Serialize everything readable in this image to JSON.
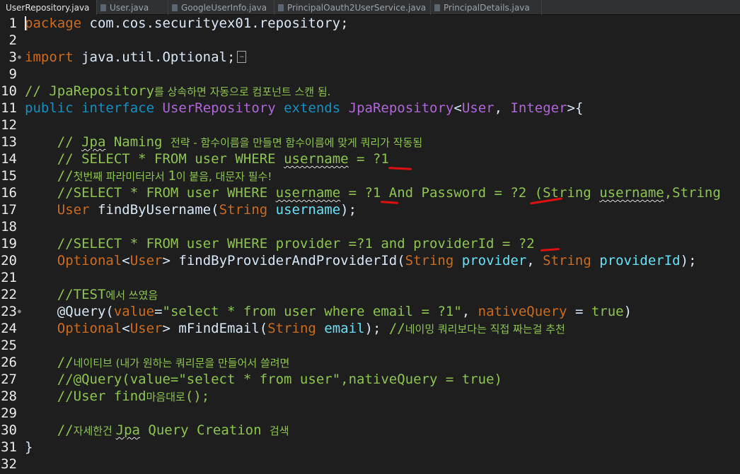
{
  "tabs": [
    {
      "label": "UserRepository.java",
      "close": "✕",
      "active": true
    },
    {
      "label": "User.java",
      "active": false
    },
    {
      "label": "GoogleUserInfo.java",
      "active": false
    },
    {
      "label": "PrincipalOauth2UserService.java",
      "active": false
    },
    {
      "label": "PrincipalDetails.java",
      "active": false
    }
  ],
  "line_numbers": [
    "1",
    "2",
    "3",
    "9",
    "10",
    "11",
    "12",
    "13",
    "14",
    "15",
    "16",
    "17",
    "18",
    "19",
    "20",
    "21",
    "22",
    "23",
    "24",
    "25",
    "26",
    "27",
    "28",
    "29",
    "30",
    "31",
    "32"
  ],
  "code": {
    "l1": {
      "kw": "package",
      "rest": " com.cos.securityex01.repository;"
    },
    "l3": {
      "kw": "import",
      "rest": " java.util.Optional;",
      "fold_box": "…"
    },
    "l10": {
      "a": "// JpaRepository",
      "b": "를 상속하면 자동으로 컴포넌트 스캔 됨."
    },
    "l11": {
      "kw1": "public",
      "kw2": "interface",
      "type1": "UserRepository",
      "kw3": "extends",
      "type2": "JpaRepository",
      "p1": "<",
      "type3": "User",
      "p2": ", ",
      "type4": "Integer",
      "p3": ">{"
    },
    "l13": {
      "a": "// ",
      "b": "Jpa",
      "c": " Naming ",
      "d": "전략 - 함수이름을 만들면 함수이름에 맞게 쿼리가 작동됨"
    },
    "l14": {
      "a": "// SELECT * FROM user WHERE ",
      "b": "username",
      "c": " = ?1"
    },
    "l15": {
      "a": "//",
      "b": "첫번째 파라미터라서 ",
      "c": "1",
      "d": "이 붙음, 대문자 필수!"
    },
    "l16": {
      "a": "//SELECT * FROM user WHERE ",
      "b": "username",
      "c": " = ?1 And Password = ?2 (String ",
      "d": "username",
      "e": ",String"
    },
    "l17": {
      "type": "User",
      "name": " findByUsername(",
      "ptype": "String",
      "pvar": " username",
      "end": ");"
    },
    "l19": {
      "a": "//SELECT * FROM user WHERE provider =?1 and providerId = ?2"
    },
    "l20": {
      "t1": "Optional",
      "p1": "<",
      "t2": "User",
      "p2": "> findByProviderAndProviderId(",
      "t3": "String",
      "v1": " provider",
      "p3": ", ",
      "t4": "String",
      "v2": " providerId",
      "p4": ");"
    },
    "l22": {
      "a": "//TEST",
      "b": "에서 쓰였음"
    },
    "l23": {
      "ann": "@Query",
      "p1": "(",
      "k1": "value",
      "p2": "=",
      "s": "\"select * from user where email = ?1\"",
      "p3": ", ",
      "k2": "nativeQuery",
      "p4": " = ",
      "k3": "true",
      "p5": ")"
    },
    "l24": {
      "t1": "Optional",
      "p1": "<",
      "t2": "User",
      "p2": "> mFindEmail(",
      "t3": "String",
      "v": " email",
      "p3": "); ",
      "c1": "//",
      "c2": "네이밍 쿼리보다는 직접 짜는걸 추천"
    },
    "l26": {
      "a": "//",
      "b": "네이티브 (내가 원하는 쿼리문을 만들어서 쓸려면"
    },
    "l27": {
      "a": "//@Query(value=\"select * from user\",nativeQuery = true)"
    },
    "l28": {
      "a": "//User find",
      "b": "마음대로",
      "c": "();"
    },
    "l30": {
      "a": "//",
      "b": "자세한건 ",
      "c": "Jpa",
      "d": " Query Creation ",
      "e": "검색"
    },
    "l31": {
      "a": "}"
    }
  },
  "colors": {
    "background": "#1e1e1e",
    "keyword": "#cc6c1d",
    "type": "#b166da",
    "comment": "#8ec54f",
    "string": "#17c6a3",
    "variable": "#66e1f8",
    "annotation_mark": "#e01010"
  },
  "icons": [
    "java-file-icon",
    "close-icon",
    "fold-marker-icon"
  ]
}
